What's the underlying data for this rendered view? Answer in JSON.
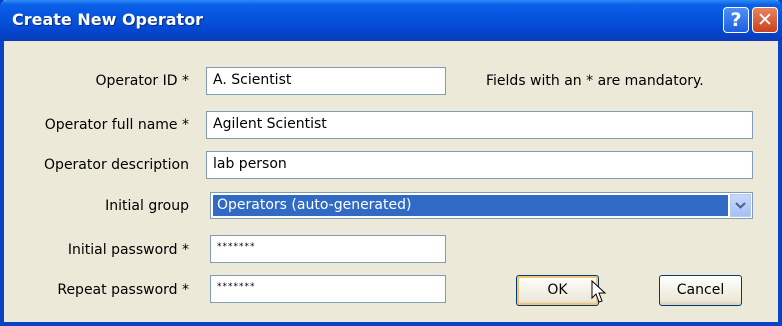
{
  "window": {
    "title": "Create New Operator",
    "help_glyph": "?",
    "close_glyph": "✕"
  },
  "form": {
    "operator_id": {
      "label": "Operator ID *",
      "value": "A. Scientist"
    },
    "full_name": {
      "label": "Operator full name *",
      "value": "Agilent Scientist"
    },
    "description": {
      "label": "Operator description",
      "value": "lab person"
    },
    "initial_group": {
      "label": "Initial group",
      "value": "Operators (auto-generated)"
    },
    "initial_password": {
      "label": "Initial password *",
      "value": "*******"
    },
    "repeat_password": {
      "label": "Repeat password *",
      "value": "*******"
    },
    "mandatory_note": "Fields with an * are mandatory."
  },
  "buttons": {
    "ok": "OK",
    "cancel": "Cancel"
  },
  "icons": {
    "help": "help-icon",
    "close": "close-icon",
    "dropdown": "chevron-down-icon",
    "cursor": "mouse-pointer-icon"
  }
}
